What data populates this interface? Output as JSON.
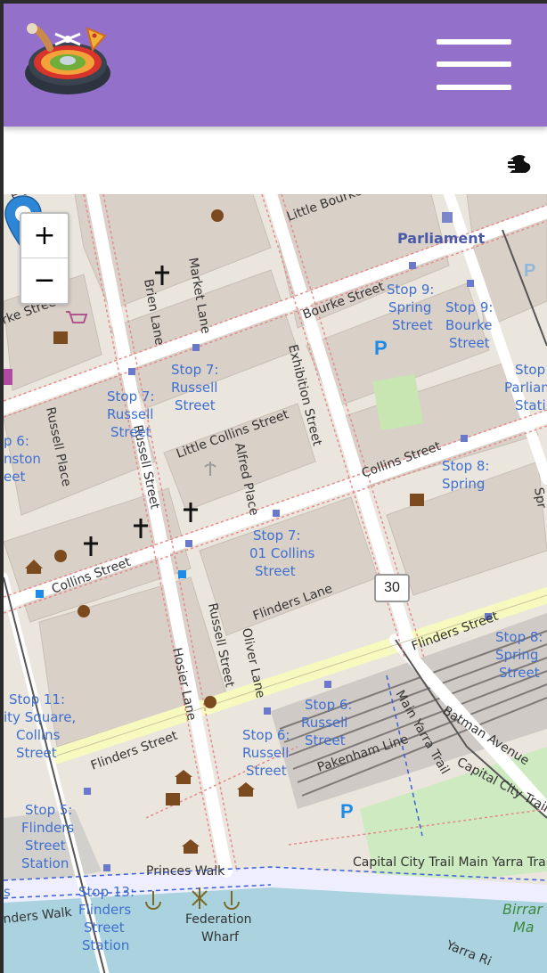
{
  "header": {
    "logo_icon": "roulette-food-logo-icon",
    "menu_icon": "hamburger-menu-icon",
    "brand_color": "#9370c9"
  },
  "toolbar": {
    "filter_icon": "filter-icon"
  },
  "map": {
    "zoom_in": "+",
    "zoom_out": "−",
    "tram_route": "30",
    "streets": {
      "little_bourke": "Little Bourke",
      "bourke": "Bourke Street",
      "bourke_left": "rke Street",
      "little_collins": "Little Collins Street",
      "collins_right": "Collins Street",
      "collins_left": "Collins Street",
      "flinders_lane": "Flinders Lane",
      "flinders_street": "Flinders Street",
      "flinders_street_left": "Flinders Street",
      "exhibition": "Exhibition Street",
      "russell_a": "Russell Street",
      "russell_b": "Russell Street",
      "russell_place": "Russell Place",
      "market_lane": "Market Lane",
      "brien_lane": "Brien Lane",
      "alfred_place": "Alfred Place",
      "oliver_lane": "Oliver Lane",
      "hosier_lane": "Hosier Lane",
      "princes_walk": "Princes Walk",
      "batman_avenue": "Batman Avenue",
      "main_yarra_trail": "Main Yarra Trail",
      "capital_city_trail": "Capital City Trail",
      "capital_city_trail_main": "Capital City Trail Main Yarra Trail",
      "pakenham_line": "Pakenham Line",
      "ers_walk": "nders Walk",
      "yarra": "Yarra Ri",
      "parliament": "Parliament",
      "federation_wharf_a": "Federation",
      "federation_wharf_b": "Wharf",
      "birrarung_a": "Birrar",
      "birrarung_b": "Ma",
      "street_top": "e Street",
      "spr": "Spr",
      "street_left_a": "Street"
    },
    "stops": {
      "s9_spring": [
        "Stop 9:",
        "Spring",
        "Street"
      ],
      "s9_bourke": [
        "Stop 9:",
        "Bourke",
        "Street"
      ],
      "s_parl": [
        "Stop",
        "Parliam",
        "Stati"
      ],
      "s7_russell_a": [
        "Stop 7:",
        "Russell",
        "Street"
      ],
      "s7_russell_b": [
        "Stop 7:",
        "Russell",
        "Street"
      ],
      "s6_left": [
        "p 6:",
        "nston",
        "eet"
      ],
      "s8_spring": [
        "Stop 8:",
        "Spring"
      ],
      "s7_collins": [
        "Stop 7:",
        "01 Collins",
        "Street"
      ],
      "s8_spring_b": [
        "Stop 8:",
        "Spring",
        "Street"
      ],
      "s11": [
        "Stop 11:",
        "ity Square,",
        "Collins",
        "Street"
      ],
      "s6_russell_a": [
        "Stop 6:",
        "Russell",
        "Street"
      ],
      "s6_russell_b": [
        "Stop 6:",
        "Russell",
        "Street"
      ],
      "s5": [
        "Stop 5:",
        "Flinders",
        "Street",
        "Station"
      ],
      "s13": [
        "Stop 13:",
        "Flinders",
        "Street",
        "Station"
      ],
      "s_left_s": [
        "s"
      ]
    },
    "pin_icon": "location-pin-icon"
  }
}
